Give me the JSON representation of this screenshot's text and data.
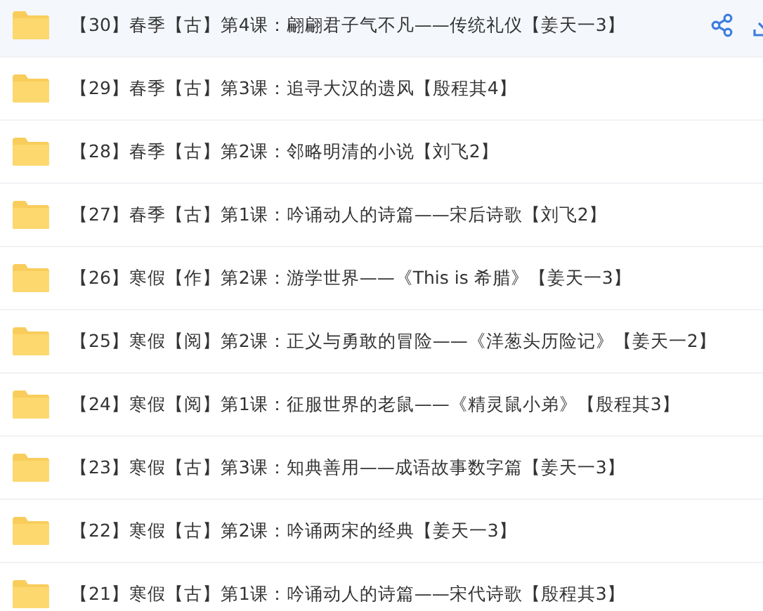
{
  "files": [
    {
      "name": "【30】春季【古】第4课：翩翩君子气不凡——传统礼仪【姜天一3】",
      "selected": true
    },
    {
      "name": "【29】春季【古】第3课：追寻大汉的遗风【殷程其4】",
      "selected": false
    },
    {
      "name": "【28】春季【古】第2课：邻略明清的小说【刘飞2】",
      "selected": false
    },
    {
      "name": "【27】春季【古】第1课：吟诵动人的诗篇——宋后诗歌【刘飞2】",
      "selected": false
    },
    {
      "name": "【26】寒假【作】第2课：游学世界——《This is 希腊》【姜天一3】",
      "selected": false
    },
    {
      "name": "【25】寒假【阅】第2课：正义与勇敢的冒险——《洋葱头历险记》【姜天一2】",
      "selected": false
    },
    {
      "name": "【24】寒假【阅】第1课：征服世界的老鼠——《精灵鼠小弟》【殷程其3】",
      "selected": false
    },
    {
      "name": "【23】寒假【古】第3课：知典善用——成语故事数字篇【姜天一3】",
      "selected": false
    },
    {
      "name": "【22】寒假【古】第2课：吟诵两宋的经典【姜天一3】",
      "selected": false
    },
    {
      "name": "【21】寒假【古】第1课：吟诵动人的诗篇——宋代诗歌【殷程其3】",
      "selected": false
    }
  ]
}
